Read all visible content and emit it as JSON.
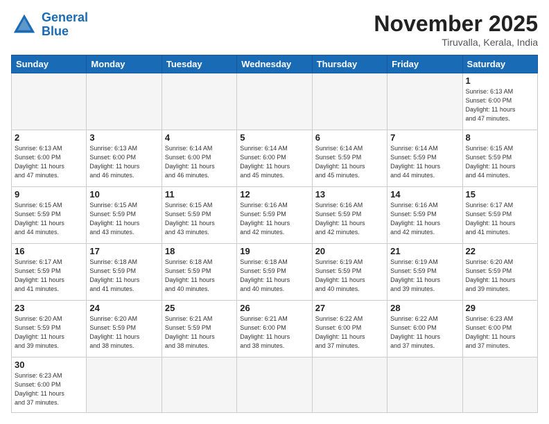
{
  "header": {
    "logo_general": "General",
    "logo_blue": "Blue",
    "month_title": "November 2025",
    "location": "Tiruvalla, Kerala, India"
  },
  "days_of_week": [
    "Sunday",
    "Monday",
    "Tuesday",
    "Wednesday",
    "Thursday",
    "Friday",
    "Saturday"
  ],
  "weeks": [
    [
      {
        "day": "",
        "info": ""
      },
      {
        "day": "",
        "info": ""
      },
      {
        "day": "",
        "info": ""
      },
      {
        "day": "",
        "info": ""
      },
      {
        "day": "",
        "info": ""
      },
      {
        "day": "",
        "info": ""
      },
      {
        "day": "1",
        "info": "Sunrise: 6:13 AM\nSunset: 6:00 PM\nDaylight: 11 hours\nand 47 minutes."
      }
    ],
    [
      {
        "day": "2",
        "info": "Sunrise: 6:13 AM\nSunset: 6:00 PM\nDaylight: 11 hours\nand 47 minutes."
      },
      {
        "day": "3",
        "info": "Sunrise: 6:13 AM\nSunset: 6:00 PM\nDaylight: 11 hours\nand 46 minutes."
      },
      {
        "day": "4",
        "info": "Sunrise: 6:14 AM\nSunset: 6:00 PM\nDaylight: 11 hours\nand 46 minutes."
      },
      {
        "day": "5",
        "info": "Sunrise: 6:14 AM\nSunset: 6:00 PM\nDaylight: 11 hours\nand 45 minutes."
      },
      {
        "day": "6",
        "info": "Sunrise: 6:14 AM\nSunset: 5:59 PM\nDaylight: 11 hours\nand 45 minutes."
      },
      {
        "day": "7",
        "info": "Sunrise: 6:14 AM\nSunset: 5:59 PM\nDaylight: 11 hours\nand 44 minutes."
      },
      {
        "day": "8",
        "info": "Sunrise: 6:15 AM\nSunset: 5:59 PM\nDaylight: 11 hours\nand 44 minutes."
      }
    ],
    [
      {
        "day": "9",
        "info": "Sunrise: 6:15 AM\nSunset: 5:59 PM\nDaylight: 11 hours\nand 44 minutes."
      },
      {
        "day": "10",
        "info": "Sunrise: 6:15 AM\nSunset: 5:59 PM\nDaylight: 11 hours\nand 43 minutes."
      },
      {
        "day": "11",
        "info": "Sunrise: 6:15 AM\nSunset: 5:59 PM\nDaylight: 11 hours\nand 43 minutes."
      },
      {
        "day": "12",
        "info": "Sunrise: 6:16 AM\nSunset: 5:59 PM\nDaylight: 11 hours\nand 42 minutes."
      },
      {
        "day": "13",
        "info": "Sunrise: 6:16 AM\nSunset: 5:59 PM\nDaylight: 11 hours\nand 42 minutes."
      },
      {
        "day": "14",
        "info": "Sunrise: 6:16 AM\nSunset: 5:59 PM\nDaylight: 11 hours\nand 42 minutes."
      },
      {
        "day": "15",
        "info": "Sunrise: 6:17 AM\nSunset: 5:59 PM\nDaylight: 11 hours\nand 41 minutes."
      }
    ],
    [
      {
        "day": "16",
        "info": "Sunrise: 6:17 AM\nSunset: 5:59 PM\nDaylight: 11 hours\nand 41 minutes."
      },
      {
        "day": "17",
        "info": "Sunrise: 6:18 AM\nSunset: 5:59 PM\nDaylight: 11 hours\nand 41 minutes."
      },
      {
        "day": "18",
        "info": "Sunrise: 6:18 AM\nSunset: 5:59 PM\nDaylight: 11 hours\nand 40 minutes."
      },
      {
        "day": "19",
        "info": "Sunrise: 6:18 AM\nSunset: 5:59 PM\nDaylight: 11 hours\nand 40 minutes."
      },
      {
        "day": "20",
        "info": "Sunrise: 6:19 AM\nSunset: 5:59 PM\nDaylight: 11 hours\nand 40 minutes."
      },
      {
        "day": "21",
        "info": "Sunrise: 6:19 AM\nSunset: 5:59 PM\nDaylight: 11 hours\nand 39 minutes."
      },
      {
        "day": "22",
        "info": "Sunrise: 6:20 AM\nSunset: 5:59 PM\nDaylight: 11 hours\nand 39 minutes."
      }
    ],
    [
      {
        "day": "23",
        "info": "Sunrise: 6:20 AM\nSunset: 5:59 PM\nDaylight: 11 hours\nand 39 minutes."
      },
      {
        "day": "24",
        "info": "Sunrise: 6:20 AM\nSunset: 5:59 PM\nDaylight: 11 hours\nand 38 minutes."
      },
      {
        "day": "25",
        "info": "Sunrise: 6:21 AM\nSunset: 5:59 PM\nDaylight: 11 hours\nand 38 minutes."
      },
      {
        "day": "26",
        "info": "Sunrise: 6:21 AM\nSunset: 6:00 PM\nDaylight: 11 hours\nand 38 minutes."
      },
      {
        "day": "27",
        "info": "Sunrise: 6:22 AM\nSunset: 6:00 PM\nDaylight: 11 hours\nand 37 minutes."
      },
      {
        "day": "28",
        "info": "Sunrise: 6:22 AM\nSunset: 6:00 PM\nDaylight: 11 hours\nand 37 minutes."
      },
      {
        "day": "29",
        "info": "Sunrise: 6:23 AM\nSunset: 6:00 PM\nDaylight: 11 hours\nand 37 minutes."
      }
    ],
    [
      {
        "day": "30",
        "info": "Sunrise: 6:23 AM\nSunset: 6:00 PM\nDaylight: 11 hours\nand 37 minutes."
      },
      {
        "day": "",
        "info": ""
      },
      {
        "day": "",
        "info": ""
      },
      {
        "day": "",
        "info": ""
      },
      {
        "day": "",
        "info": ""
      },
      {
        "day": "",
        "info": ""
      },
      {
        "day": "",
        "info": ""
      }
    ]
  ]
}
